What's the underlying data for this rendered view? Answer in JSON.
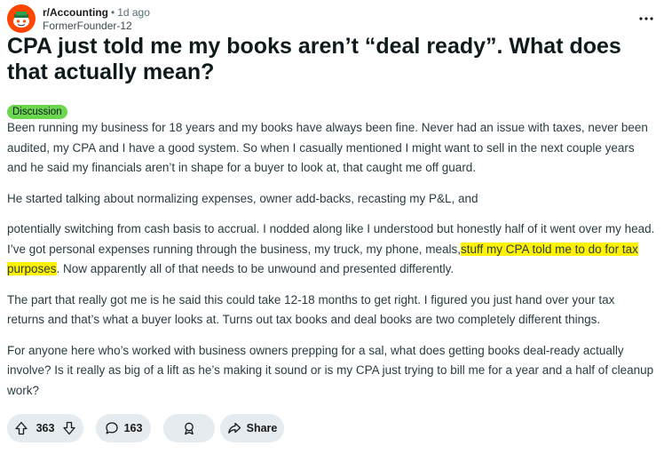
{
  "post": {
    "subreddit": "r/Accounting",
    "separator": "•",
    "time_ago": "1d ago",
    "author": "FormerFounder-12",
    "title": "CPA just told me my books aren’t “deal ready”. What does that actually mean?",
    "flair": "Discussion",
    "paragraphs": {
      "p1": "Been running my business for 18 years and my books have always been fine. Never had an issue with taxes, never been audited, my CPA and I have a good system. So when I casually mentioned I might want to sell in the next couple years and he said my financials aren’t in shape for a buyer to look at, that caught me off guard.",
      "p2": "He started talking about normalizing expenses, owner add-backs, recasting my P&L, and",
      "p3_before": "potentially switching from cash basis to accrual. I nodded along like I understood but honestly half of it went over my head. I’ve got personal expenses running through the business, my truck, my phone, meals,",
      "p3_highlight": "stuff my CPA told me to do for tax purposes",
      "p3_after": ". Now apparently all of that needs to be unwound and presented differently.",
      "p4": "The part that really got me is he said this could take 12-18 months to get right. I figured you just hand over your tax returns and that’s what a buyer looks at. Turns out tax books and deal books are two completely different things.",
      "p5": "For anyone here who’s worked with business owners prepping for a sal, what does getting books deal-ready actually involve? Is it really as big of a lift as he’s making it sound or is my CPA just trying to bill me for a year and a half of cleanup work?"
    }
  },
  "actions": {
    "upvotes": "363",
    "comments": "163",
    "share_label": "Share"
  },
  "icons": {
    "avatar": "snoo-avatar-icon",
    "more": "more-options-icon",
    "upvote": "upvote-arrow-icon",
    "downvote": "downvote-arrow-icon",
    "comment": "comment-bubble-icon",
    "award": "award-icon",
    "share": "share-arrow-icon"
  },
  "colors": {
    "flair_bg": "#6ad74f",
    "highlight": "#fff200",
    "avatar_bg": "#ff4500",
    "pill_bg": "#e5ebee"
  }
}
